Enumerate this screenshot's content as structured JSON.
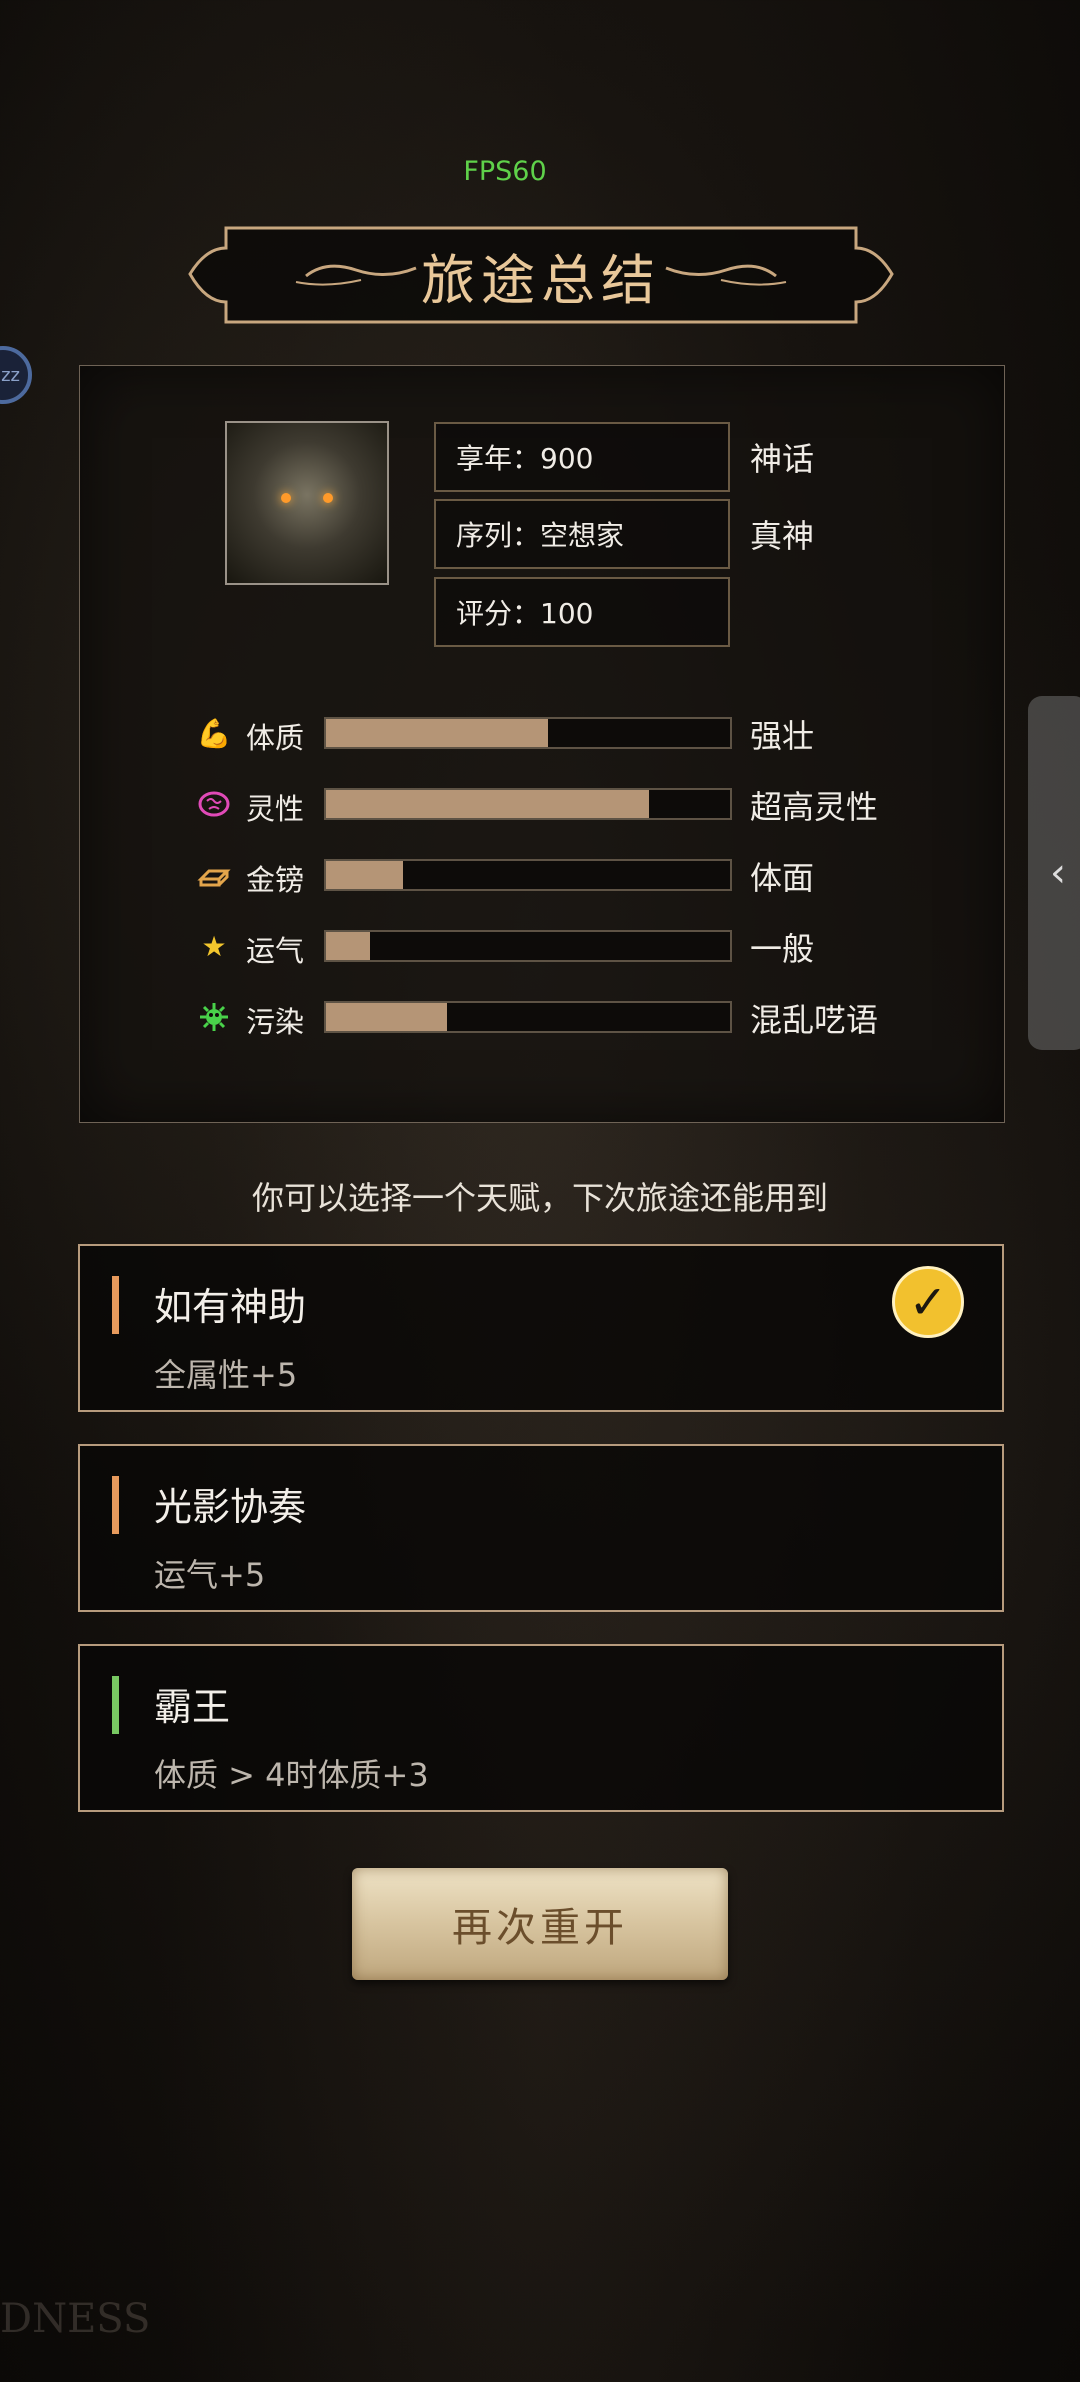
{
  "fps": "FPS60",
  "title": "旅途总结",
  "bubble_text": "zz",
  "profile": {
    "age": "享年：900",
    "age_tag": "神话",
    "sequence": "序列：空想家",
    "sequence_tag": "真神",
    "score": "评分：100"
  },
  "stats": [
    {
      "label": "体质",
      "fill": 0.55,
      "desc": "强壮",
      "icon": "flexed-arm-icon",
      "color": "#f07f2a"
    },
    {
      "label": "灵性",
      "fill": 0.8,
      "desc": "超高灵性",
      "icon": "brain-icon",
      "color": "#e14ab8"
    },
    {
      "label": "金镑",
      "fill": 0.19,
      "desc": "体面",
      "icon": "gold-bars-icon",
      "color": "#e3a54b"
    },
    {
      "label": "运气",
      "fill": 0.11,
      "desc": "一般",
      "icon": "star-icon",
      "color": "#f3c62d"
    },
    {
      "label": "污染",
      "fill": 0.3,
      "desc": "混乱呓语",
      "icon": "germ-icon",
      "color": "#49d24a"
    }
  ],
  "prompt": "你可以选择一个天赋，下次旅途还能用到",
  "talents": [
    {
      "name": "如有神助",
      "desc": "全属性+5",
      "bar_color": "#e79a5c",
      "selected": true
    },
    {
      "name": "光影协奏",
      "desc": "运气+5",
      "bar_color": "#e79a5c",
      "selected": false
    },
    {
      "name": "霸王",
      "desc": "体质 > 4时体质+3",
      "bar_color": "#78c862",
      "selected": false
    }
  ],
  "restart_label": "再次重开",
  "watermark": "DNESS"
}
